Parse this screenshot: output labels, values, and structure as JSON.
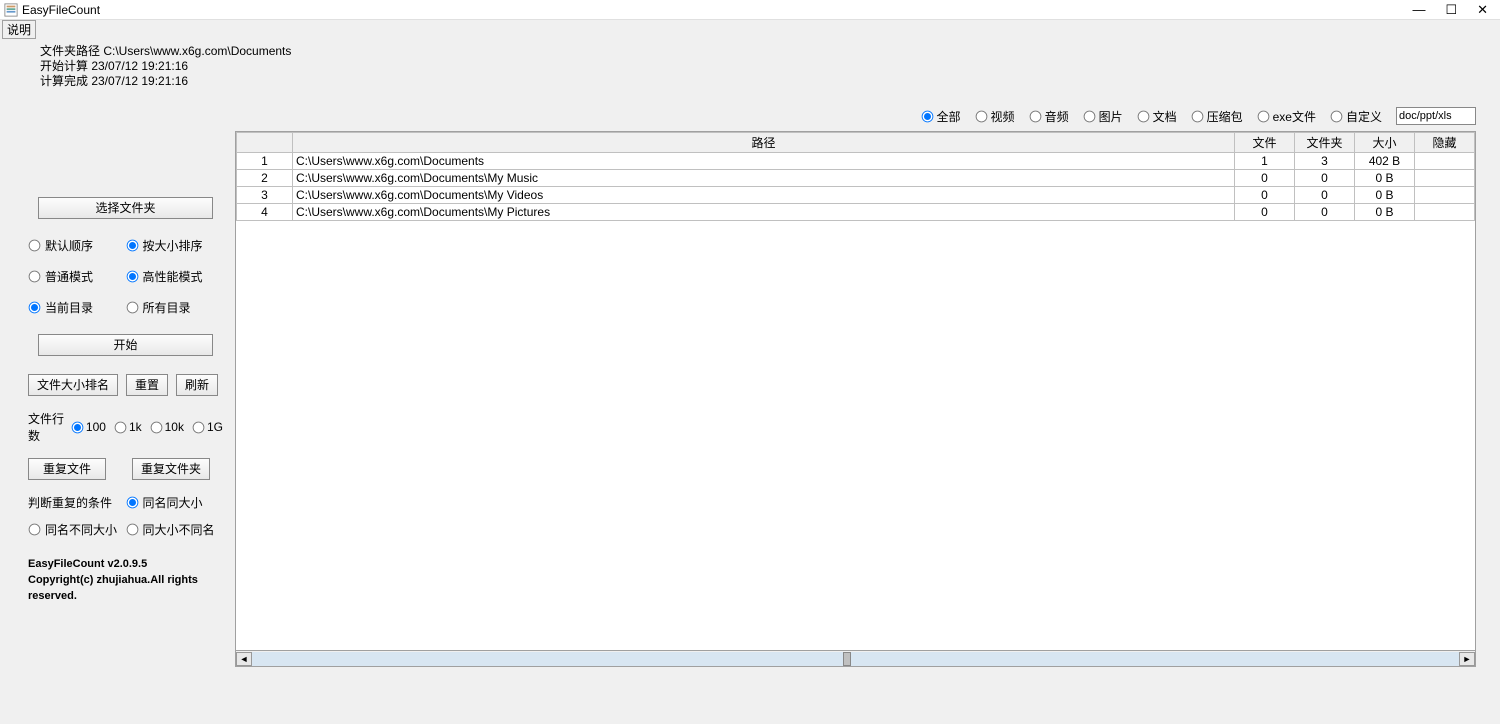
{
  "window": {
    "title": "EasyFileCount"
  },
  "menu": {
    "desc": "说明"
  },
  "info": {
    "path_label": "文件夹路径 C:\\Users\\www.x6g.com\\Documents",
    "start_label": "开始计算 23/07/12 19:21:16",
    "done_label": "计算完成 23/07/12 19:21:16"
  },
  "filters": {
    "all": "全部",
    "video": "视频",
    "audio": "音频",
    "image": "图片",
    "doc": "文档",
    "archive": "压缩包",
    "exe": "exe文件",
    "custom": "自定义",
    "custom_value": "doc/ppt/xls"
  },
  "sidebar": {
    "select_folder": "选择文件夹",
    "sort": {
      "default": "默认顺序",
      "size": "按大小排序"
    },
    "mode": {
      "normal": "普通模式",
      "high": "高性能模式"
    },
    "scope": {
      "current": "当前目录",
      "all": "所有目录"
    },
    "start": "开始",
    "buttons": {
      "sort_size": "文件大小排名",
      "reset": "重置",
      "refresh": "刷新"
    },
    "rows": {
      "label": "文件行数",
      "r100": "100",
      "r1k": "1k",
      "r10k": "10k",
      "r1g": "1G"
    },
    "dup": {
      "file": "重复文件",
      "folder": "重复文件夹"
    },
    "cond": {
      "label": "判断重复的条件",
      "same": "同名同大小",
      "name_diff": "同名不同大小",
      "size_diff": "同大小不同名"
    },
    "version": "EasyFileCount v2.0.9.5",
    "copyright": "Copyright(c) zhujiahua.All rights reserved."
  },
  "table": {
    "headers": {
      "path": "路径",
      "file": "文件",
      "folder": "文件夹",
      "size": "大小",
      "hidden": "隐藏"
    },
    "rows": [
      {
        "idx": "1",
        "path": "C:\\Users\\www.x6g.com\\Documents",
        "file": "1",
        "folder": "3",
        "size": "402 B",
        "hidden": ""
      },
      {
        "idx": "2",
        "path": "C:\\Users\\www.x6g.com\\Documents\\My Music",
        "file": "0",
        "folder": "0",
        "size": "0 B",
        "hidden": ""
      },
      {
        "idx": "3",
        "path": "C:\\Users\\www.x6g.com\\Documents\\My Videos",
        "file": "0",
        "folder": "0",
        "size": "0 B",
        "hidden": ""
      },
      {
        "idx": "4",
        "path": "C:\\Users\\www.x6g.com\\Documents\\My Pictures",
        "file": "0",
        "folder": "0",
        "size": "0 B",
        "hidden": ""
      }
    ]
  }
}
